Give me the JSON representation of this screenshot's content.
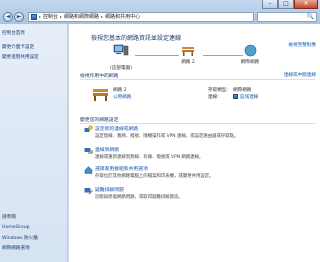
{
  "navbar": {
    "breadcrumbs": [
      "控制台",
      "網路和網際網路",
      "網路和共用中心"
    ],
    "back_glyph": "◄",
    "forward_glyph": "►",
    "search_glyph": "🔍"
  },
  "window": {
    "min_glyph": "–",
    "max_glyph": "□",
    "close_glyph": "✕"
  },
  "sidebar": {
    "items": [
      "控制台首頁",
      "變更介面卡設定",
      "變更進階共用設定"
    ],
    "see_also_title": "請參閱",
    "see_also": [
      "HomeGroup",
      "Windows 防火牆",
      "網際網路選項"
    ]
  },
  "main": {
    "heading": "檢視您基本的網路資訊並設定連線",
    "full_map_link": "檢視完整對應",
    "network_map": {
      "nodes": [
        {
          "label": "",
          "sublabel": "(這部電腦)"
        },
        {
          "label": "網路 2"
        },
        {
          "label": "網際網路"
        }
      ]
    },
    "active_section": {
      "label": "檢視作用中的網路",
      "right_link": "連線或中斷連線",
      "network_name": "網路 2",
      "network_type": "公用網路",
      "access_type_label": "存取類型:",
      "access_type_value": "網際網路",
      "connections_label": "連線:",
      "connections_value": "區域連線"
    },
    "change_section": {
      "label": "變更您的網路設定",
      "tasks": [
        {
          "title": "設定新的連線或網路",
          "desc": "設定無線、寬頻、撥號、隨機操作或 VPN 連線，或設定路由器或存取點。"
        },
        {
          "title": "連線到網路",
          "desc": "連線或重新連線到無線、有線、撥號或 VPN 網路連線。"
        },
        {
          "title": "選擇家用群組和共用選項",
          "desc": "存取位於其他網路電腦上的檔案和印表機，或變更共用設定。"
        },
        {
          "title": "疑難排解問題",
          "desc": "診斷與修復網路問題，或取得疑難排解資訊。"
        }
      ]
    }
  }
}
